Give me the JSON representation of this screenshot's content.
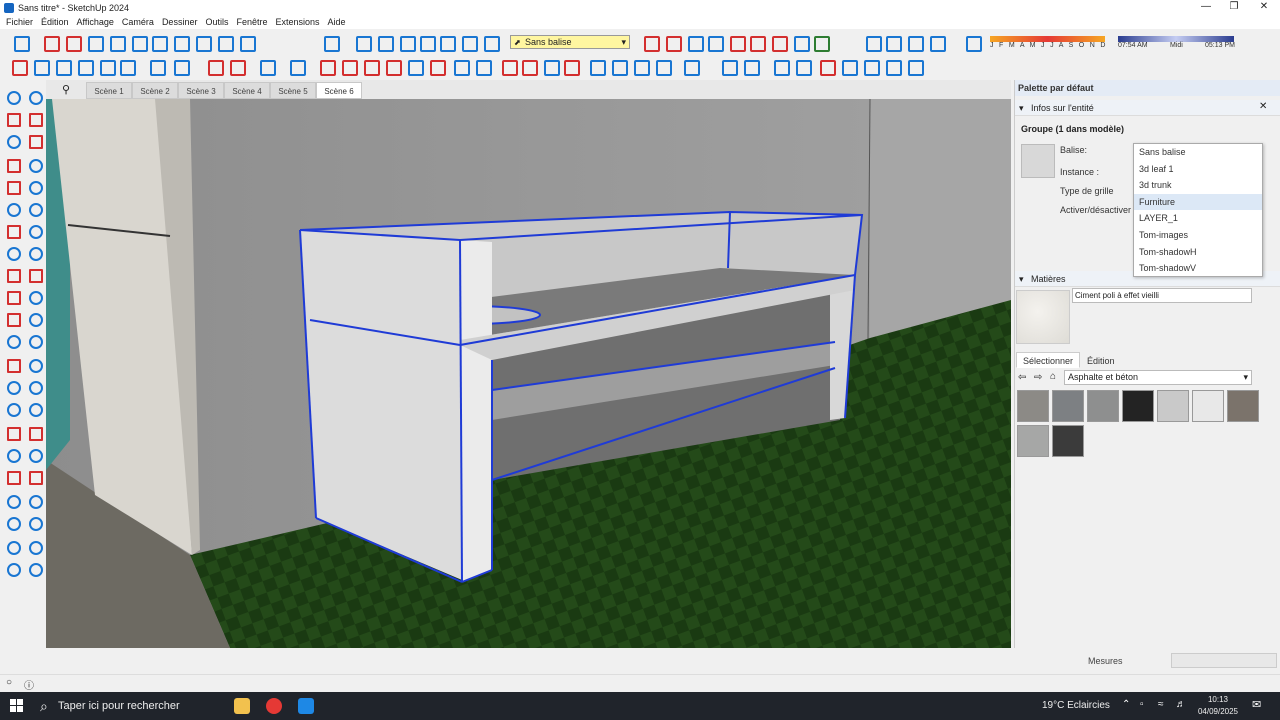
{
  "window": {
    "title": "Sans titre* - SketchUp 2024"
  },
  "menu": [
    "Fichier",
    "Édition",
    "Affichage",
    "Caméra",
    "Dessiner",
    "Outils",
    "Fenêtre",
    "Extensions",
    "Aide"
  ],
  "toolbar": {
    "balise_value": "Sans balise",
    "shadow_months": "J F M A M J J A S O N D",
    "time_start": "07:54 AM",
    "time_mid": "Midi",
    "time_end": "05:13 PM"
  },
  "scenes": [
    "Scène 1",
    "Scène 2",
    "Scène 3",
    "Scène 4",
    "Scène 5",
    "Scène 6"
  ],
  "active_scene": "Scène 6",
  "palette": {
    "title": "Palette par défaut",
    "entity_section": "Infos sur l'entité",
    "entity_title": "Groupe (1 dans modèle)",
    "labels": {
      "balise": "Balise:",
      "instance": "Instance :",
      "grid": "Type de grille",
      "toggle": "Activer/désactiver :"
    },
    "balise_options": [
      "Sans balise",
      "3d leaf 1",
      "3d trunk",
      "Furniture",
      "LAYER_1",
      "Tom-images",
      "Tom-shadowH",
      "Tom-shadowV"
    ],
    "highlighted_option": "Furniture",
    "materials_section": "Matières",
    "material_name": "Ciment poli à effet vieilli",
    "tab_select": "Sélectionner",
    "tab_edit": "Édition",
    "category": "Asphalte et béton",
    "swatch_colors": [
      "#8c8a86",
      "#7d8083",
      "#8e8f8f",
      "#232323",
      "#c9c9c9",
      "#e8e8e8",
      "#7b736b",
      "#a6a7a6",
      "#3b3b3b"
    ]
  },
  "status": {
    "measurements_label": "Mesures"
  },
  "taskbar": {
    "search_placeholder": "Taper ici pour rechercher",
    "weather": "19°C  Eclaircies",
    "time": "10:13",
    "date": "04/09/2025"
  }
}
